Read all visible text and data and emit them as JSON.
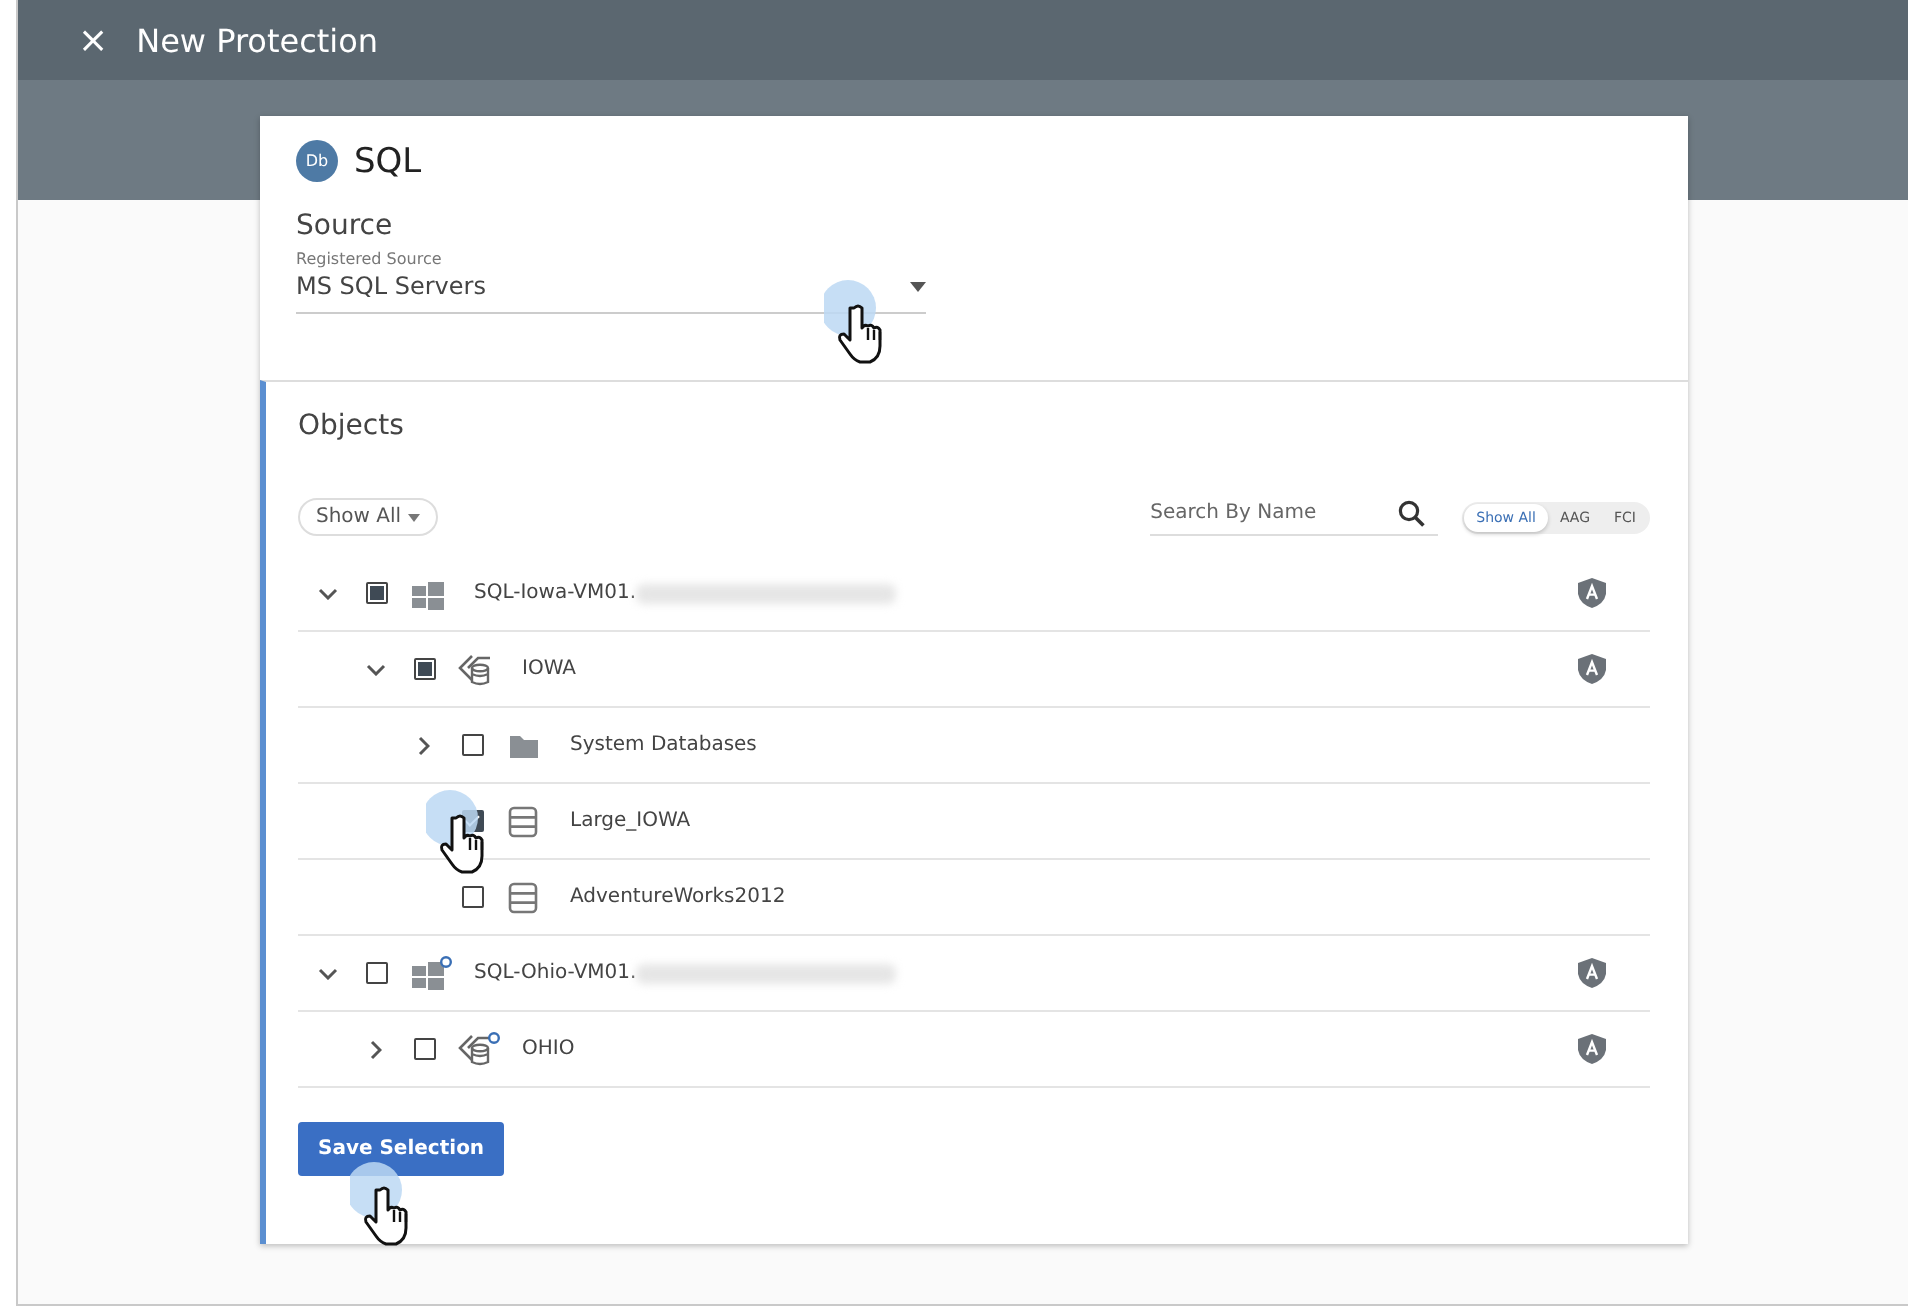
{
  "window": {
    "close": "×",
    "title": "New Protection"
  },
  "source_type": {
    "badge": "Db",
    "title": "SQL"
  },
  "source": {
    "heading": "Source",
    "field_label": "Registered Source",
    "value": "MS SQL Servers"
  },
  "objects": {
    "heading": "Objects",
    "filter": "Show All",
    "search_placeholder": "Search By Name",
    "segments": [
      {
        "label": "Show All",
        "selected": true
      },
      {
        "label": "AAG",
        "selected": false
      },
      {
        "label": "FCI",
        "selected": false
      }
    ],
    "tree": [
      {
        "label": "SQL-Iowa-VM01.",
        "kind": "host",
        "checked": false,
        "partial": true,
        "expanded": true,
        "redacted": true,
        "aag": true,
        "badge": false,
        "children": [
          {
            "label": "IOWA",
            "kind": "instance",
            "checked": false,
            "partial": true,
            "expanded": true,
            "redacted": false,
            "aag": true,
            "badge": false,
            "children": [
              {
                "label": "System Databases",
                "kind": "folder",
                "checked": false,
                "partial": false,
                "expanded": false,
                "redacted": false,
                "aag": false,
                "badge": false
              },
              {
                "label": "Large_IOWA",
                "kind": "database",
                "checked": true,
                "partial": false,
                "redacted": false,
                "aag": false,
                "badge": false
              },
              {
                "label": "AdventureWorks2012",
                "kind": "database",
                "checked": false,
                "partial": false,
                "redacted": false,
                "aag": false,
                "badge": false
              }
            ]
          }
        ]
      },
      {
        "label": "SQL-Ohio-VM01.",
        "kind": "host",
        "checked": false,
        "partial": false,
        "expanded": true,
        "redacted": true,
        "aag": true,
        "badge": true,
        "children": [
          {
            "label": "OHIO",
            "kind": "instance",
            "checked": false,
            "partial": false,
            "expanded": false,
            "redacted": false,
            "aag": true,
            "badge": true
          }
        ]
      }
    ]
  },
  "save_button": "Save Selection"
}
